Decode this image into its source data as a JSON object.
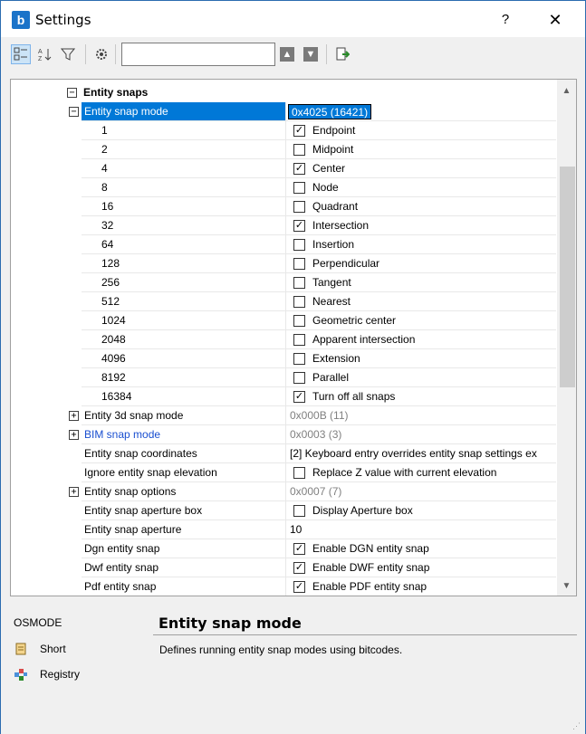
{
  "window": {
    "title": "Settings",
    "help_label": "?",
    "close_label": "✕"
  },
  "toolbar": {
    "search_value": ""
  },
  "group": {
    "label": "Entity snaps",
    "expander": "−"
  },
  "rows": [
    {
      "name": "Entity snap mode",
      "value": "0x4025 (16421)",
      "type": "edit",
      "expander": "−",
      "selected": true
    },
    {
      "name": "1",
      "label": "Endpoint",
      "checked": "✓",
      "type": "bit"
    },
    {
      "name": "2",
      "label": "Midpoint",
      "checked": "",
      "type": "bit"
    },
    {
      "name": "4",
      "label": "Center",
      "checked": "✓",
      "type": "bit"
    },
    {
      "name": "8",
      "label": "Node",
      "checked": "",
      "type": "bit"
    },
    {
      "name": "16",
      "label": "Quadrant",
      "checked": "",
      "type": "bit"
    },
    {
      "name": "32",
      "label": "Intersection",
      "checked": "✓",
      "type": "bit"
    },
    {
      "name": "64",
      "label": "Insertion",
      "checked": "",
      "type": "bit"
    },
    {
      "name": "128",
      "label": "Perpendicular",
      "checked": "",
      "type": "bit"
    },
    {
      "name": "256",
      "label": "Tangent",
      "checked": "",
      "type": "bit"
    },
    {
      "name": "512",
      "label": "Nearest",
      "checked": "",
      "type": "bit"
    },
    {
      "name": "1024",
      "label": "Geometric center",
      "checked": "",
      "type": "bit"
    },
    {
      "name": "2048",
      "label": "Apparent intersection",
      "checked": "",
      "type": "bit"
    },
    {
      "name": "4096",
      "label": "Extension",
      "checked": "",
      "type": "bit"
    },
    {
      "name": "8192",
      "label": "Parallel",
      "checked": "",
      "type": "bit"
    },
    {
      "name": "16384",
      "label": "Turn off all snaps",
      "checked": "✓",
      "type": "bit"
    },
    {
      "name": "Entity 3d snap mode",
      "value": "0x000B (11)",
      "type": "gray",
      "expander": "+"
    },
    {
      "name": "BIM snap mode",
      "value": "0x0003 (3)",
      "type": "gray",
      "expander": "+",
      "link": true
    },
    {
      "name": "Entity snap coordinates",
      "value": "[2] Keyboard entry overrides entity snap settings ex",
      "type": "text"
    },
    {
      "name": "Ignore entity snap elevation",
      "label": "Replace Z value with current elevation",
      "checked": "",
      "type": "check"
    },
    {
      "name": "Entity snap options",
      "value": "0x0007 (7)",
      "type": "gray",
      "expander": "+"
    },
    {
      "name": "Entity snap aperture box",
      "label": "Display Aperture box",
      "checked": "",
      "type": "check"
    },
    {
      "name": "Entity snap aperture",
      "value": "10",
      "type": "text"
    },
    {
      "name": "Dgn entity snap",
      "label": "Enable DGN entity snap",
      "checked": "✓",
      "type": "check"
    },
    {
      "name": "Dwf entity snap",
      "label": "Enable DWF entity snap",
      "checked": "✓",
      "type": "check"
    },
    {
      "name": "Pdf entity snap",
      "label": "Enable PDF entity snap",
      "checked": "✓",
      "type": "check"
    }
  ],
  "description": {
    "variable": "OSMODE",
    "short_label": "Short",
    "registry_label": "Registry",
    "title": "Entity snap mode",
    "text": "Defines running entity snap modes using bitcodes."
  }
}
